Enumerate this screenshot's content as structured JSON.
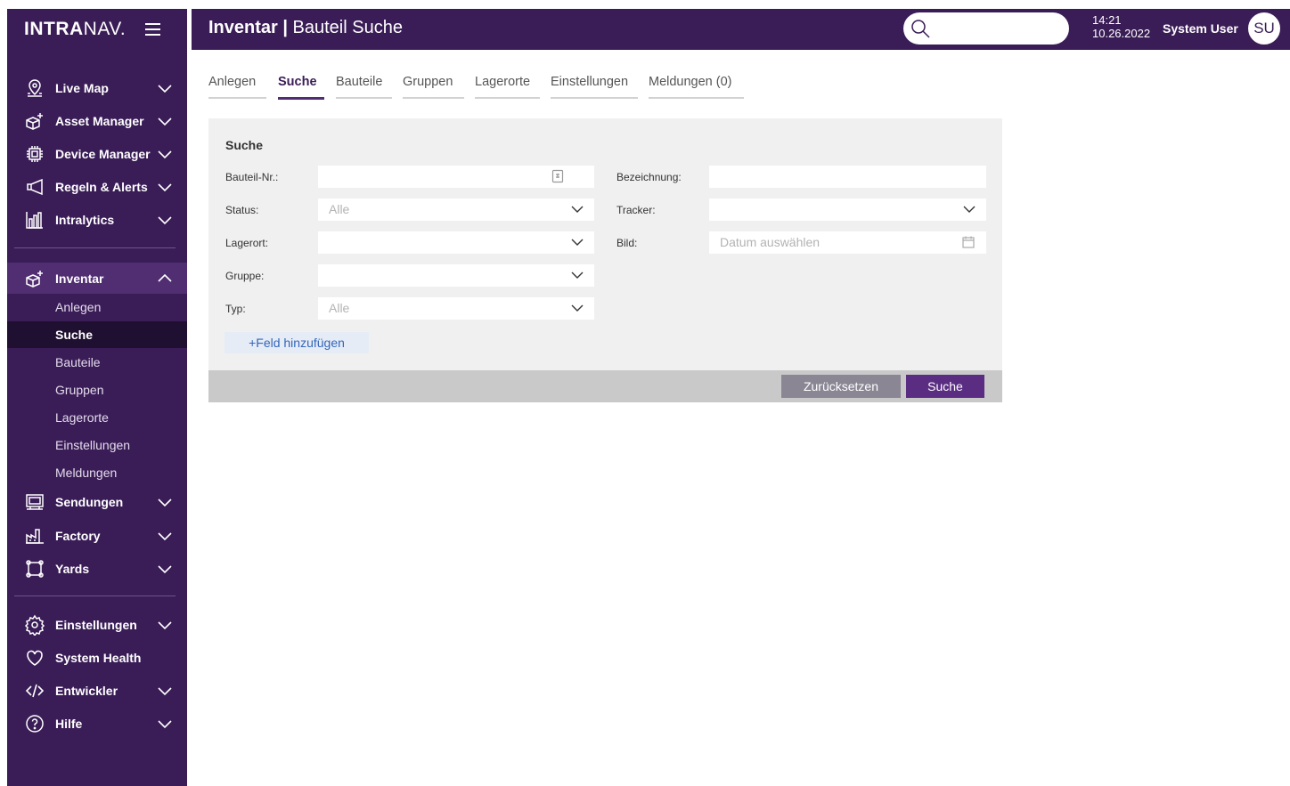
{
  "sidebar": {
    "logo_bold": "INTRA",
    "logo_light": "NAV.",
    "items": [
      {
        "label": "Live Map",
        "icon": "map-pin-icon"
      },
      {
        "label": "Asset Manager",
        "icon": "asset-cube-icon"
      },
      {
        "label": "Device Manager",
        "icon": "chip-icon"
      },
      {
        "label": "Regeln & Alerts",
        "icon": "megaphone-icon"
      },
      {
        "label": "Intralytics",
        "icon": "bar-chart-icon"
      },
      {
        "label": "Inventar",
        "icon": "inventory-cube-icon"
      },
      {
        "label": "Sendungen",
        "icon": "shipment-icon"
      },
      {
        "label": "Factory",
        "icon": "factory-icon"
      },
      {
        "label": "Yards",
        "icon": "yard-icon"
      },
      {
        "label": "Einstellungen",
        "icon": "gear-icon"
      },
      {
        "label": "System Health",
        "icon": "heart-icon"
      },
      {
        "label": "Entwickler",
        "icon": "code-icon"
      },
      {
        "label": "Hilfe",
        "icon": "help-icon"
      }
    ],
    "inventar_sub": [
      "Anlegen",
      "Suche",
      "Bauteile",
      "Gruppen",
      "Lagerorte",
      "Einstellungen",
      "Meldungen"
    ]
  },
  "header": {
    "title_strong": "Inventar |",
    "title_rest": "Bauteil Suche",
    "time": "14:21",
    "date": "10.26.2022",
    "user_name": "System User",
    "avatar_initials": "SU"
  },
  "tabs": [
    "Anlegen",
    "Suche",
    "Bauteile",
    "Gruppen",
    "Lagerorte",
    "Einstellungen",
    "Meldungen (0)"
  ],
  "search_panel": {
    "title": "Suche",
    "labels": {
      "bauteil_nr": "Bauteil-Nr.:",
      "status": "Status:",
      "lagerort": "Lagerort:",
      "gruppe": "Gruppe:",
      "typ": "Typ:",
      "bezeichnung": "Bezeichnung:",
      "tracker": "Tracker:",
      "bild": "Bild:"
    },
    "values": {
      "bauteil_nr": "",
      "status": "Alle",
      "lagerort": "",
      "gruppe": "",
      "typ": "Alle",
      "bezeichnung": "",
      "tracker": "",
      "bild_placeholder": "Datum auswählen"
    },
    "add_field": "+Feld hinzufügen",
    "reset_button": "Zurücksetzen",
    "search_button": "Suche"
  },
  "colors": {
    "brand": "#3a1d57",
    "active_nav": "#512e72",
    "primary_button": "#5a2d82",
    "secondary_button": "#8a8694"
  }
}
